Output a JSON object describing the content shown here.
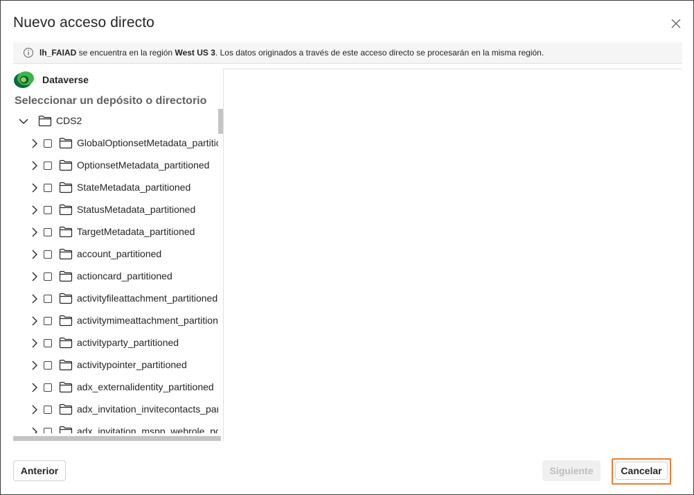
{
  "dialog": {
    "title": "Nuevo acceso directo",
    "close_icon": "close-icon"
  },
  "info": {
    "icon": "info-icon",
    "workspace": "lh_FAIAD",
    "text_a": " se encuentra en la región ",
    "region": "West US 3",
    "text_b": ". Los datos originados a través de este acceso directo se procesarán en la misma región."
  },
  "source": {
    "icon": "dataverse-logo",
    "name": "Dataverse"
  },
  "tree": {
    "label": "Seleccionar un depósito o directorio",
    "root": "CDS2",
    "items": [
      {
        "label": "GlobalOptionsetMetadata_partitioned"
      },
      {
        "label": "OptionsetMetadata_partitioned"
      },
      {
        "label": "StateMetadata_partitioned"
      },
      {
        "label": "StatusMetadata_partitioned"
      },
      {
        "label": "TargetMetadata_partitioned"
      },
      {
        "label": "account_partitioned"
      },
      {
        "label": "actioncard_partitioned"
      },
      {
        "label": "activityfileattachment_partitioned"
      },
      {
        "label": "activitymimeattachment_partitioned"
      },
      {
        "label": "activityparty_partitioned"
      },
      {
        "label": "activitypointer_partitioned"
      },
      {
        "label": "adx_externalidentity_partitioned"
      },
      {
        "label": "adx_invitation_invitecontacts_partitioned"
      },
      {
        "label": "adx_invitation_mspp_webrole_powerpagecomponent"
      }
    ]
  },
  "footer": {
    "back": "Anterior",
    "next": "Siguiente",
    "cancel": "Cancelar"
  },
  "colors": {
    "highlight": "#ed7d31",
    "disabled_text": "#bdbdbd",
    "info_bg": "#f5f5f5"
  }
}
